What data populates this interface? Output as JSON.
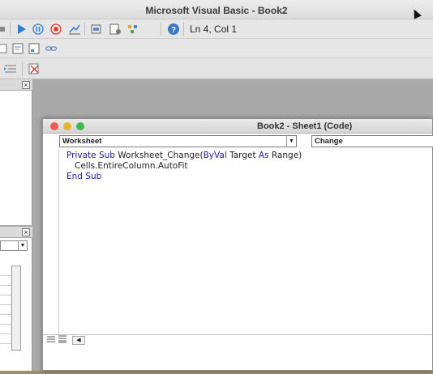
{
  "window": {
    "title": "Microsoft Visual Basic - Book2"
  },
  "toolbar": {
    "position_text": "Ln 4, Col 1"
  },
  "code_window": {
    "title": "Book2 - Sheet1 (Code)",
    "object_combo": "Worksheet",
    "procedure_combo": "Change",
    "lines": [
      {
        "kw1": "Private Sub ",
        "text": "Worksheet_Change(",
        "kw2": "ByVal",
        "text2": " Target ",
        "kw3": "As",
        "text3": " Range)"
      },
      {
        "text": "Cells.EntireColumn.AutoFit"
      },
      {
        "kw1": "End Sub"
      }
    ]
  },
  "colors": {
    "keyword": "#1b1b9a",
    "run": "#2a7fd6",
    "stop": "#d33a2c"
  }
}
